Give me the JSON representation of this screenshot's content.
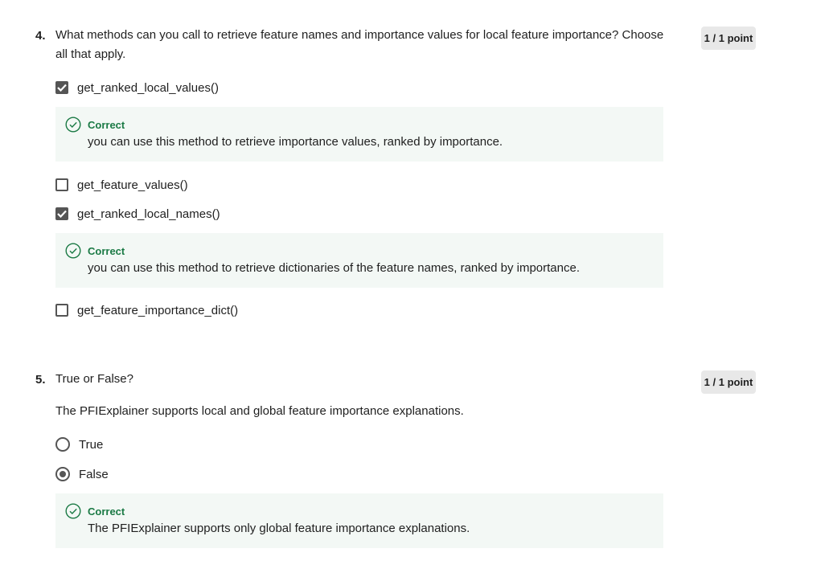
{
  "questions": [
    {
      "number": "4.",
      "prompt": "What methods can you call to retrieve feature names and importance values for local feature importance? Choose all that apply.",
      "points": "1 / 1 point",
      "options": [
        {
          "label": "get_ranked_local_values()",
          "checked": true,
          "feedback_title": "Correct",
          "feedback_text": "you can use this method to retrieve importance values, ranked by importance."
        },
        {
          "label": "get_feature_values()",
          "checked": false
        },
        {
          "label": "get_ranked_local_names()",
          "checked": true,
          "feedback_title": "Correct",
          "feedback_text": "you can use this method to retrieve dictionaries of the feature names, ranked by importance."
        },
        {
          "label": "get_feature_importance_dict()",
          "checked": false
        }
      ]
    },
    {
      "number": "5.",
      "prompt": "True or False?",
      "statement": "The PFIExplainer supports local and global feature importance explanations.",
      "points": "1 / 1 point",
      "options": [
        {
          "label": "True",
          "selected": false
        },
        {
          "label": "False",
          "selected": true,
          "feedback_title": "Correct",
          "feedback_text": "The PFIExplainer supports only global feature importance explanations."
        }
      ]
    }
  ],
  "colors": {
    "correct_green": "#1b7a45",
    "feedback_bg": "#f3f8f5",
    "points_badge_bg": "#e8e8e8",
    "control_gray": "#555555"
  },
  "icons": {
    "checkmark": "check-icon",
    "feedback": "check-circle-icon"
  }
}
